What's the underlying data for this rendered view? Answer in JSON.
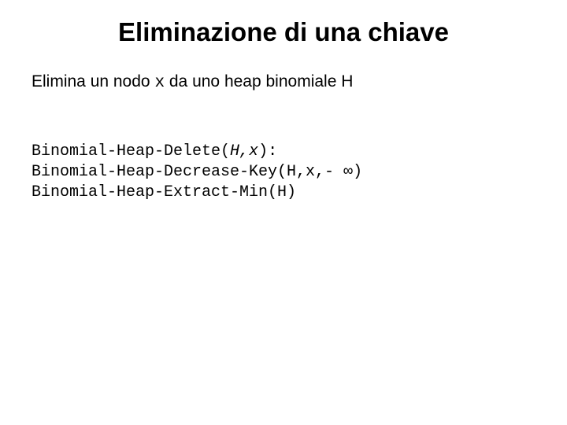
{
  "title": "Eliminazione di una chiave",
  "description": {
    "pre": "Elimina un nodo ",
    "var": "x",
    "post": " da uno heap binomiale H"
  },
  "code": {
    "l1a": "Binomial-Heap-Delete(",
    "l1b": "H,x",
    "l1c": "):",
    "l2": "Binomial-Heap-Decrease-Key(H,x,- ∞)",
    "l3": "Binomial-Heap-Extract-Min(H)"
  }
}
